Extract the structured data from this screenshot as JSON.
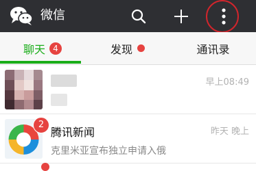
{
  "app": {
    "title": "微信"
  },
  "toolbar": {
    "search_icon": "search-icon",
    "add_icon": "plus-icon",
    "more_icon": "more-vertical-icon"
  },
  "tabs": [
    {
      "label": "聊天",
      "badge": "4",
      "active": true
    },
    {
      "label": "发现",
      "badge_dot": true
    },
    {
      "label": "通讯录"
    }
  ],
  "chats": [
    {
      "name": "",
      "preview": "",
      "time": "早上08:49"
    },
    {
      "name": "腾讯新闻",
      "preview": "克里米亚宣布独立申请入俄",
      "time": "昨天 晚上",
      "unread": "2"
    }
  ],
  "colors": {
    "topbar": "#2e2f33",
    "accent": "#1aad19",
    "badge": "#e64340",
    "annotation": "#d1252c"
  }
}
